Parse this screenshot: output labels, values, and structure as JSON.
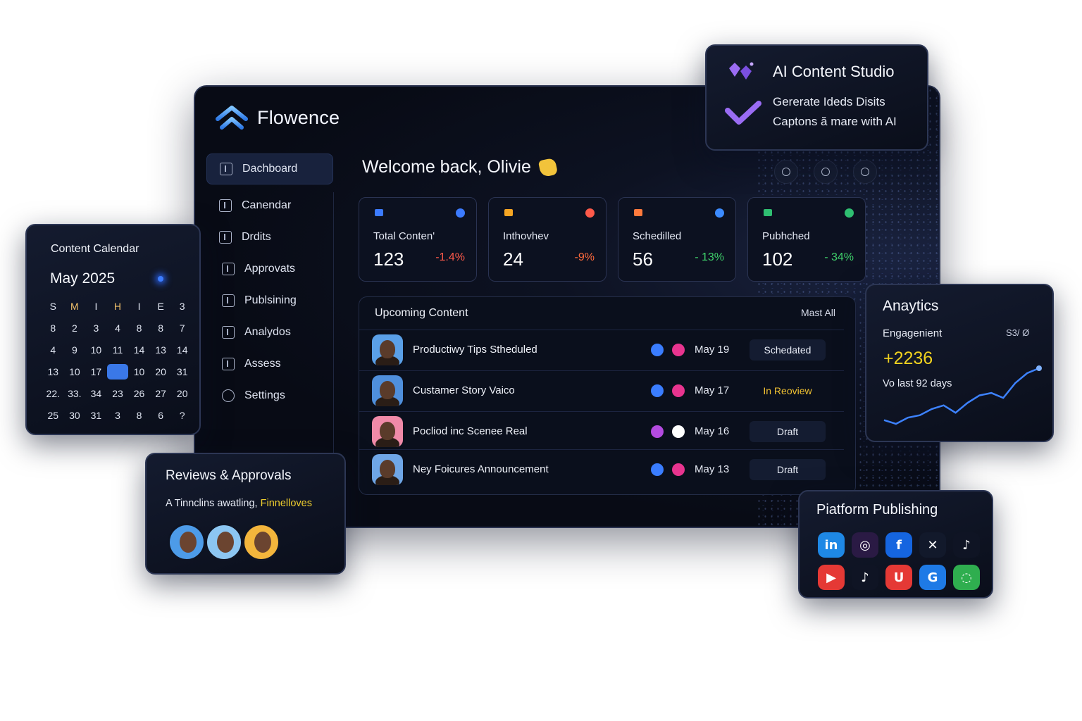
{
  "app": {
    "name": "Flowence"
  },
  "sidebar": {
    "items": [
      {
        "label": "Dachboard",
        "active": true
      },
      {
        "label": "Canendar"
      },
      {
        "label": "Drdits"
      },
      {
        "label": "Approvats"
      },
      {
        "label": "Publsining"
      },
      {
        "label": "Analydos"
      },
      {
        "label": "Assess"
      },
      {
        "label": "Settings"
      }
    ]
  },
  "header": {
    "welcome": "Welcome back, Olivie"
  },
  "stats": [
    {
      "label": "Total Conten'",
      "value": "123",
      "change": "-1.4%",
      "change_color": "#ff5a4a",
      "icon_left": "#3c7bff",
      "icon_right": "#3c7bff"
    },
    {
      "label": "Inthovhev",
      "value": "24",
      "change": "-9%",
      "change_color": "#ff6a3c",
      "icon_left": "#f6a623",
      "icon_right": "#ff5a4a"
    },
    {
      "label": "Schedilled",
      "value": "56",
      "change": "- 13%",
      "change_color": "#3fd16b",
      "icon_left": "#ff7a3c",
      "icon_right": "#3c8bff"
    },
    {
      "label": "Pubhched",
      "value": "102",
      "change": "- 34%",
      "change_color": "#3fd16b",
      "icon_left": "#2fbf71",
      "icon_right": "#2fbf71"
    }
  ],
  "upcoming": {
    "title": "Upcoming Content",
    "mark_all": "Mast All",
    "rows": [
      {
        "title": "Productiwy Tips Stheduled",
        "date": "May 19",
        "status": "Schedated",
        "status_type": "default",
        "avatar_bg": "#5aa0e8",
        "p1": "#3a7dff",
        "p2": "#e8348f"
      },
      {
        "title": "Custamer Story Vaico",
        "date": "May 17",
        "status": "In Reoview",
        "status_type": "review",
        "avatar_bg": "#4f8fdc",
        "p1": "#3a7dff",
        "p2": "#e8348f"
      },
      {
        "title": "Pocliod inc Scenee Real",
        "date": "May 16",
        "status": "Draft",
        "status_type": "default",
        "avatar_bg": "#f08aa8",
        "p1": "#b44be0",
        "p2": "#ffffff"
      },
      {
        "title": "Ney  Foicures Announcement",
        "date": "May 13",
        "status": "Draft",
        "status_type": "default",
        "avatar_bg": "#6fa6e6",
        "p1": "#3a7dff",
        "p2": "#e8348f"
      }
    ]
  },
  "ai_studio": {
    "title": "AI Content Studio",
    "line1": "Gererate Ideds Disits",
    "line2": "Captons ă mare with AI"
  },
  "calendar": {
    "title": "Content Calendar",
    "month": "May 2025",
    "headers": [
      "S",
      "M",
      "I",
      "H",
      "I",
      "E",
      "3"
    ],
    "days": [
      "8",
      "2",
      "3",
      "4",
      "8",
      "8",
      "7",
      "4",
      "9",
      "10",
      "11",
      "14",
      "13",
      "14",
      "13",
      "10",
      "17",
      "",
      "10",
      "20",
      "31",
      "22.",
      "33.",
      "34",
      "23",
      "26",
      "27",
      "20",
      "25",
      "30",
      "31",
      "3",
      "8",
      "6",
      "?"
    ],
    "highlight_index": 17
  },
  "reviews": {
    "title": "Reviews & Approvals",
    "subtitle": "A Tinnclins awatling,",
    "highlight": "Finnelloves",
    "avatar_colors": [
      "#4d9be8",
      "#8cc6f2",
      "#f3b53c"
    ]
  },
  "analytics": {
    "title": "Anaytics",
    "label": "Engagenient",
    "range": "S3/ Ø",
    "value": "+2236",
    "period": "Vo last 92 days",
    "series": [
      42,
      45,
      40,
      38,
      33,
      30,
      36,
      28,
      22,
      20,
      24,
      12,
      4,
      0
    ]
  },
  "publishing": {
    "title": "Piatform Publishing",
    "icons": [
      {
        "name": "linkedin-icon",
        "glyph": "in",
        "color": "#1e88e5"
      },
      {
        "name": "instagram-icon",
        "glyph": "◎",
        "color": "#2a1a44"
      },
      {
        "name": "facebook-icon",
        "glyph": "f",
        "color": "#1565e0"
      },
      {
        "name": "x-icon",
        "glyph": "✕",
        "color": "#12192b"
      },
      {
        "name": "tiktok-icon",
        "glyph": "♪",
        "color": "#0f1424"
      },
      {
        "name": "youtube-icon",
        "glyph": "▶",
        "color": "#e53935"
      },
      {
        "name": "tiktok-alt-icon",
        "glyph": "♪",
        "color": "#0f1424"
      },
      {
        "name": "u-icon",
        "glyph": "U",
        "color": "#e53935"
      },
      {
        "name": "google-icon",
        "glyph": "G",
        "color": "#1e7ae6"
      },
      {
        "name": "chat-icon",
        "glyph": "◌",
        "color": "#2fae4f"
      }
    ]
  }
}
